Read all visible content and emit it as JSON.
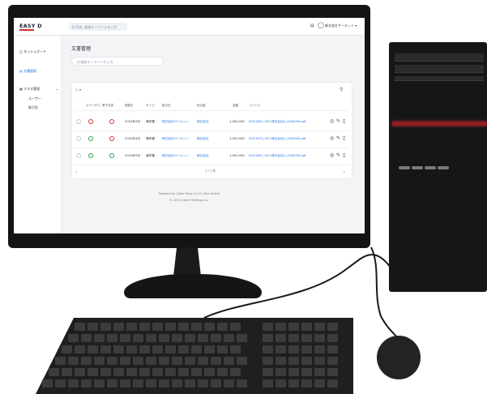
{
  "app": {
    "logo": "EASY D",
    "global_search_placeholder": "Q  ID名, 検索キーワードを入力",
    "company_menu": "株式会社サーキット ▾"
  },
  "sidebar": {
    "items": [
      {
        "label": "ダッシュボード"
      },
      {
        "label": "文書管理"
      },
      {
        "label": "マスタ管理"
      },
      {
        "label": "ユーザー"
      },
      {
        "label": "取引先"
      }
    ]
  },
  "main": {
    "title": "文書管理",
    "search_placeholder": "Q  検索キーワードを入力",
    "filter_dropdown": "▢ ▾",
    "table": {
      "columns": [
        "ステータス",
        "電子文書",
        "登録日",
        "タイプ",
        "取引先",
        "担当者",
        "金額",
        "ファイル"
      ],
      "rows": [
        {
          "date": "2024年3月",
          "type": "請求書",
          "vendor": "株式会社サーキット",
          "person": "株式会社",
          "amount": "1,000,000",
          "file": "DOC4001_003 株式会社A_1000000.pdf"
        },
        {
          "date": "2024年4月",
          "type": "請求書",
          "vendor": "株式会社サーキット",
          "person": "株式会社",
          "amount": "1,000,000",
          "file": "DOC4070_003 株式会社A_1000000.pdf"
        },
        {
          "date": "2024年5月",
          "type": "請求書",
          "vendor": "株式会社サーキット",
          "person": "株式会社",
          "amount": "1,000,000",
          "file": "DOC4001_003 株式会社A_1000000.pdf"
        }
      ],
      "pagination": "1 / 1 件"
    }
  },
  "footer": {
    "line1": "Powered by Cyber Rims v1.0.2 (Dev Stack)",
    "line2": "© 2024 Cyber Holdings Inc."
  },
  "colors": {
    "accent": "#1f6fe5",
    "status_red": "#d32f2f",
    "status_green": "#2e9e4f"
  }
}
